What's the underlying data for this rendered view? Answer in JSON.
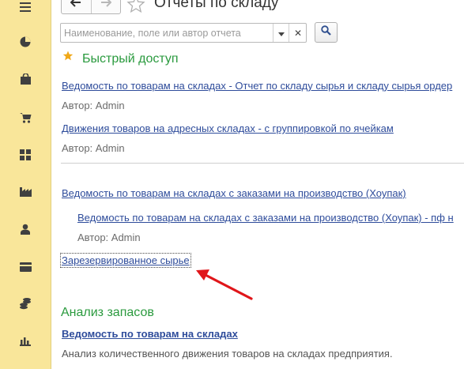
{
  "header": {
    "title": "Отчеты по складу",
    "back_icon": "arrow-left-icon",
    "forward_icon": "arrow-right-icon",
    "favorite_icon": "star-outline-icon"
  },
  "search": {
    "placeholder": "Наименование, поле или автор отчета",
    "value": ""
  },
  "sidebar": {
    "items": [
      {
        "icon": "menu-icon"
      },
      {
        "icon": "pie-chart-icon"
      },
      {
        "icon": "shopping-bag-icon"
      },
      {
        "icon": "cart-icon"
      },
      {
        "icon": "grid-icon"
      },
      {
        "icon": "factory-icon"
      },
      {
        "icon": "person-icon"
      },
      {
        "icon": "card-icon"
      },
      {
        "icon": "coins-icon"
      },
      {
        "icon": "bar-chart-icon"
      }
    ]
  },
  "quick_access": {
    "title": "Быстрый доступ",
    "items": [
      {
        "link": "Ведомость по товарам на складах - Отчет по складу сырья и складу сырья ордер",
        "author": "Автор: Admin"
      },
      {
        "link": "Движения товаров на адресных складах - с группировкой по ячейкам",
        "author": "Автор: Admin"
      }
    ]
  },
  "reports": {
    "parent": "Ведомость по товарам на складах с заказами на производство (Хоупак)",
    "child": "Ведомость по товарам на складах с заказами на производство (Хоупак) - пф н",
    "child_author": "Автор: Admin",
    "focused": "Зарезервированное сырье"
  },
  "stock_analysis": {
    "title": "Анализ запасов",
    "link": "Ведомость по товарам на складах",
    "description": "Анализ количественного движения товаров на складах предприятия."
  },
  "colors": {
    "sidebar": "#f9e69a",
    "link": "#2e4c9b",
    "section": "#2a9a3e",
    "star": "#f0a818",
    "annotation_arrow": "#e0161a"
  }
}
